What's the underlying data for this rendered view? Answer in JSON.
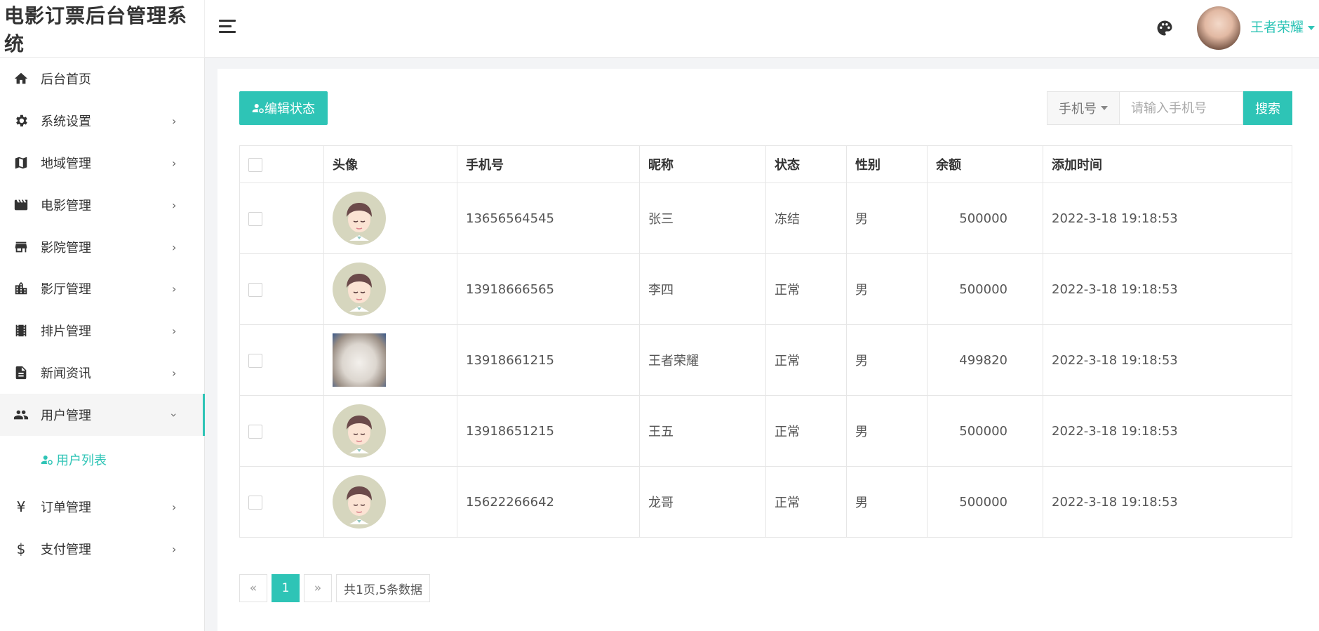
{
  "app": {
    "title": "电影订票后台管理系统"
  },
  "header": {
    "user_name": "王者荣耀"
  },
  "sidebar": {
    "items": [
      {
        "label": "后台首页",
        "icon": "home-icon"
      },
      {
        "label": "系统设置",
        "icon": "gear-icon"
      },
      {
        "label": "地域管理",
        "icon": "map-icon"
      },
      {
        "label": "电影管理",
        "icon": "clapperboard-icon"
      },
      {
        "label": "影院管理",
        "icon": "store-icon"
      },
      {
        "label": "影厅管理",
        "icon": "building-icon"
      },
      {
        "label": "排片管理",
        "icon": "film-strip-icon"
      },
      {
        "label": "新闻资讯",
        "icon": "document-icon"
      },
      {
        "label": "用户管理",
        "icon": "users-icon"
      },
      {
        "label": "订单管理",
        "icon": "yen-icon"
      },
      {
        "label": "支付管理",
        "icon": "dollar-icon"
      }
    ],
    "sub_item": {
      "label": "用户列表",
      "icon": "user-settings-icon"
    }
  },
  "toolbar": {
    "edit_status_label": "编辑状态",
    "search_field_select": "手机号",
    "search_placeholder": "请输入手机号",
    "search_button": "搜索"
  },
  "table": {
    "columns": [
      "头像",
      "手机号",
      "昵称",
      "状态",
      "性别",
      "余额",
      "添加时间"
    ],
    "rows": [
      {
        "phone": "13656564545",
        "nickname": "张三",
        "status": "冻结",
        "gender": "男",
        "balance": "500000",
        "time": "2022-3-18 19:18:53"
      },
      {
        "phone": "13918666565",
        "nickname": "李四",
        "status": "正常",
        "gender": "男",
        "balance": "500000",
        "time": "2022-3-18 19:18:53"
      },
      {
        "phone": "13918661215",
        "nickname": "王者荣耀",
        "status": "正常",
        "gender": "男",
        "balance": "499820",
        "time": "2022-3-18 19:18:53"
      },
      {
        "phone": "13918651215",
        "nickname": "王五",
        "status": "正常",
        "gender": "男",
        "balance": "500000",
        "time": "2022-3-18 19:18:53"
      },
      {
        "phone": "15622266642",
        "nickname": "龙哥",
        "status": "正常",
        "gender": "男",
        "balance": "500000",
        "time": "2022-3-18 19:18:53"
      }
    ]
  },
  "pagination": {
    "prev": "«",
    "current": "1",
    "next": "»",
    "info": "共1页,5条数据"
  },
  "colors": {
    "accent": "#2ec4b6",
    "status_frozen": "#f0a03c",
    "status_ok": "#2eb872"
  }
}
